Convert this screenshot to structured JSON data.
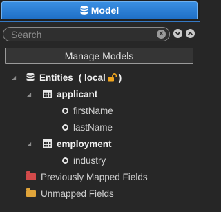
{
  "header": {
    "tab_label": "Model",
    "tab_icon": "database-icon"
  },
  "search": {
    "placeholder": "Search",
    "value": ""
  },
  "toolbar": {
    "manage_models_label": "Manage Models"
  },
  "tree": {
    "root": {
      "label": "Entities",
      "suffix_open": "( local",
      "suffix_close": ")"
    },
    "entities": [
      {
        "label": "applicant",
        "fields": [
          "firstName",
          "lastName"
        ]
      },
      {
        "label": "employment",
        "fields": [
          "industry"
        ]
      }
    ],
    "previously_mapped": "Previously Mapped Fields",
    "unmapped": "Unmapped Fields"
  },
  "colors": {
    "accent": "#2a7dd6",
    "background": "#272727",
    "lock": "#f0a51e",
    "previously_mapped_folder": "#d24a4a",
    "unmapped_folder": "#e0a43a"
  }
}
